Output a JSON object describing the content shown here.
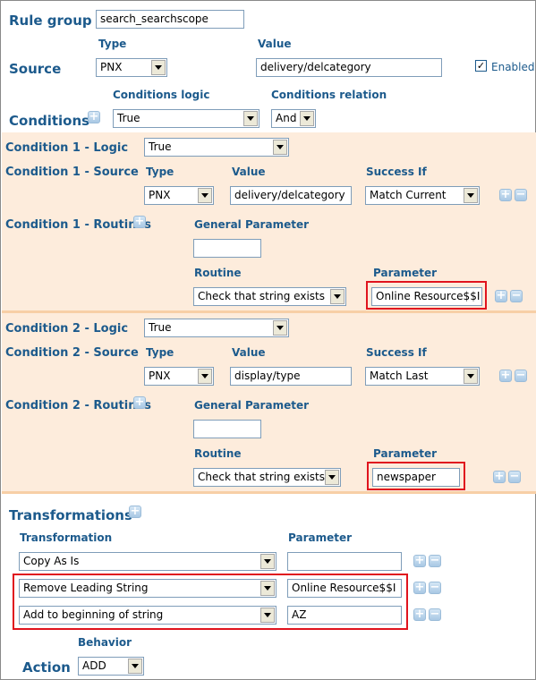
{
  "rule_group": {
    "label": "Rule group",
    "value": "search_searchscope"
  },
  "source": {
    "label": "Source",
    "type_header": "Type",
    "value_header": "Value",
    "type_value": "PNX",
    "value": "delivery/delcategory",
    "enabled_label": "Enabled",
    "enabled_checked": true
  },
  "conditions": {
    "label": "Conditions",
    "logic_header": "Conditions logic",
    "relation_header": "Conditions relation",
    "logic_value": "True",
    "relation_value": "And"
  },
  "condition1": {
    "logic_label": "Condition 1 - Logic",
    "logic_value": "True",
    "source_label": "Condition 1 - Source",
    "type_header": "Type",
    "value_header": "Value",
    "success_header": "Success If",
    "type_value": "PNX",
    "value": "delivery/delcategory",
    "success_value": "Match Current",
    "routines_label": "Condition 1 - Routines",
    "general_param_header": "General Parameter",
    "general_param_value": "",
    "routine_header": "Routine",
    "parameter_header": "Parameter",
    "routine_value": "Check that string exists",
    "parameter_value": "Online Resource$$I"
  },
  "condition2": {
    "logic_label": "Condition 2 - Logic",
    "logic_value": "True",
    "source_label": "Condition 2 - Source",
    "type_header": "Type",
    "value_header": "Value",
    "success_header": "Success If",
    "type_value": "PNX",
    "value": "display/type",
    "success_value": "Match Last",
    "routines_label": "Condition 2 - Routines",
    "general_param_header": "General Parameter",
    "general_param_value": "",
    "routine_header": "Routine",
    "parameter_header": "Parameter",
    "routine_value": "Check that string exists",
    "parameter_value": "newspaper"
  },
  "transformations": {
    "label": "Transformations",
    "transformation_header": "Transformation",
    "parameter_header": "Parameter",
    "rows": [
      {
        "transformation": "Copy As Is",
        "parameter": ""
      },
      {
        "transformation": "Remove Leading String",
        "parameter": "Online Resource$$I"
      },
      {
        "transformation": "Add to beginning of string",
        "parameter": "AZ"
      }
    ]
  },
  "action": {
    "label": "Action",
    "behavior_header": "Behavior",
    "value": "ADD"
  },
  "icons": {
    "add": "plus-icon",
    "remove": "minus-icon",
    "dropdown": "chevron-down-icon"
  },
  "colors": {
    "label_blue": "#1c5a8c",
    "band_bg": "#fdecdc",
    "separator": "#f7cfa6",
    "highlight_red": "#e0141e"
  },
  "glyphs": {
    "plus": "+",
    "minus": "−",
    "check": "✓"
  }
}
